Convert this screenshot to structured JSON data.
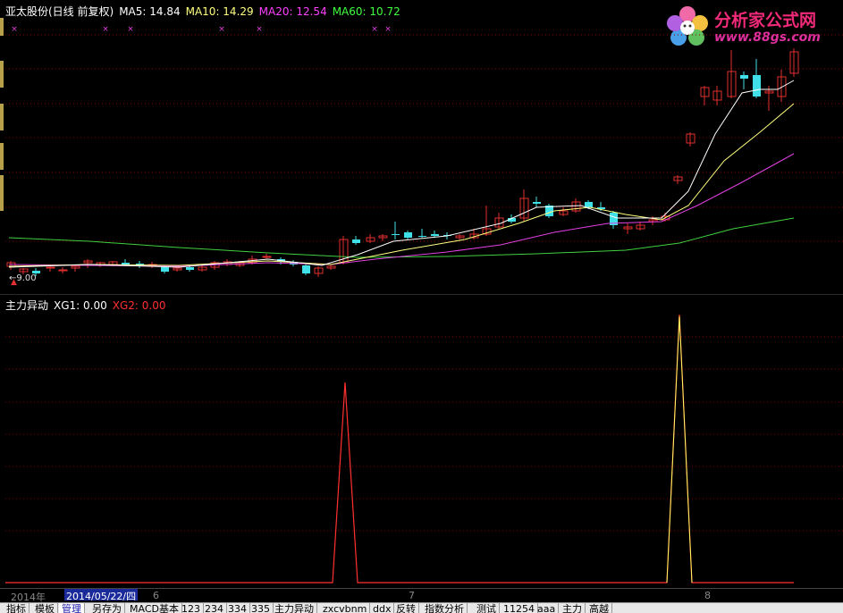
{
  "main_header": {
    "stock": "亚太股份(日线 前复权)",
    "ma5_label": "MA5: 14.84",
    "ma10_label": "MA10: 14.29",
    "ma20_label": "MA20: 12.54",
    "ma60_label": "MA60: 10.72",
    "colors": {
      "stock": "#ffffff",
      "ma5": "#ffffff",
      "ma10": "#ffff80",
      "ma20": "#ff40ff",
      "ma60": "#40ff40"
    }
  },
  "sub_header": {
    "name": "主力异动",
    "xg1_label": "XG1: 0.00",
    "xg2_label": "XG2: 0.00",
    "colors": {
      "xg1": "#ffffff",
      "xg2": "#ff3030"
    }
  },
  "price_label": "←9.00",
  "watermark": {
    "title": "分析家公式网",
    "url": "www.88gs.com"
  },
  "date_bar": {
    "year": "2014年",
    "selected_date": "2014/05/22/四",
    "months": [
      "6",
      "7",
      "8"
    ]
  },
  "tabs": [
    "指标",
    "模板",
    "管理",
    "另存为",
    "MACD基本",
    "123",
    "234",
    "334",
    "335",
    "主力异动",
    "zxcvbnm",
    "ddx",
    "反转",
    "指数分析",
    "测试",
    "11254",
    "aaa",
    "主力",
    "高越"
  ],
  "active_tab": "管理",
  "colors": {
    "up": "#e03030",
    "down": "#40e0e8",
    "grid": "#8b0000",
    "signal_line": "#ff3030",
    "signal_yellow": "#ffff60"
  },
  "chart_data": {
    "type": "candlestick",
    "price_marker": 9.0,
    "moving_averages": [
      "MA5",
      "MA10",
      "MA20",
      "MA60"
    ],
    "signal_indicator": {
      "name": "主力异动",
      "series": [
        {
          "name": "XG1",
          "peaks": 2,
          "current": 0.0
        },
        {
          "name": "XG2",
          "peaks": 2,
          "current": 0.0
        }
      ]
    }
  }
}
